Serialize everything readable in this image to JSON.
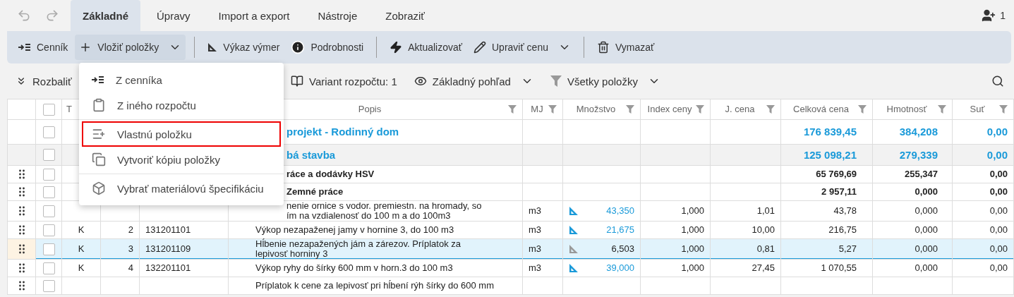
{
  "tabs": [
    {
      "label": "Základné",
      "selected": true
    },
    {
      "label": "Úpravy",
      "selected": false
    },
    {
      "label": "Import a export",
      "selected": false
    },
    {
      "label": "Nástroje",
      "selected": false
    },
    {
      "label": "Zobraziť",
      "selected": false
    }
  ],
  "user_count": "1",
  "ribbon": [
    {
      "kind": "pricelist",
      "label": "Cenník"
    },
    {
      "kind": "insert",
      "label": "Vložiť položky",
      "expanded": true
    },
    {
      "kind": "separator"
    },
    {
      "kind": "measure",
      "label": "Výkaz výmer"
    },
    {
      "kind": "info",
      "label": "Podrobnosti"
    },
    {
      "kind": "separator"
    },
    {
      "kind": "update",
      "label": "Aktualizovať"
    },
    {
      "kind": "edit",
      "label": "Upraviť cenu",
      "dropdown": true
    },
    {
      "kind": "separator"
    },
    {
      "kind": "delete",
      "label": "Vymazať"
    }
  ],
  "view_bar": [
    {
      "kind": "expand",
      "label": "Rozbaliť"
    },
    {
      "kind": "variant",
      "label": "Variant rozpočtu: 1"
    },
    {
      "kind": "view",
      "label": "Základný pohľad"
    },
    {
      "kind": "filter",
      "label": "Všetky položky"
    }
  ],
  "menu": [
    {
      "kind": "pricelist",
      "label": "Z cenníka",
      "highlighted": false
    },
    {
      "kind": "budget",
      "label": "Z iného rozpočtu",
      "highlighted": false
    },
    {
      "kind": "divider"
    },
    {
      "kind": "custom",
      "label": "Vlastnú položku",
      "highlighted": true
    },
    {
      "kind": "copy",
      "label": "Vytvoriť kópiu položky",
      "highlighted": false
    },
    {
      "kind": "divider"
    },
    {
      "kind": "material",
      "label": "Vybrať materiálovú špecifikáciu",
      "highlighted": false
    }
  ],
  "table": {
    "all_checked": false,
    "columns": [
      {
        "label": "T"
      },
      {},
      {},
      {
        "label": "Popis",
        "filter": true
      },
      {
        "label": "MJ",
        "filter": true
      },
      {
        "label": "Množstvo",
        "filter": true
      },
      {
        "label": "Index ceny",
        "filter": true
      },
      {
        "label": "J. cena",
        "filter": true
      },
      {
        "label": "Celková cena",
        "filter": true
      },
      {
        "label": "Hmotnosť",
        "filter": true
      },
      {
        "label": "Suť",
        "filter": true
      }
    ],
    "rows": [
      {
        "kind": "project",
        "covered": true,
        "selected": false,
        "popis": "projekt - Rodinný dom",
        "total": "176 839,45",
        "weight": "384,208",
        "debris": "0,00"
      },
      {
        "kind": "object",
        "covered": true,
        "selected": false,
        "popis": "bá stavba",
        "total": "125 098,21",
        "weight": "279,339",
        "debris": "0,00"
      },
      {
        "kind": "section",
        "covered": true,
        "selected": false,
        "popis": "ráce a dodávky HSV",
        "total": "65 769,69",
        "weight": "255,347",
        "debris": "0,00"
      },
      {
        "kind": "section",
        "covered": true,
        "selected": false,
        "popis": "Zemné práce",
        "total": "2 957,11",
        "weight": "0,000",
        "debris": "0,00"
      },
      {
        "kind": "item",
        "covered": true,
        "selected": false,
        "linked": true,
        "popis": "nenie ornice s vodor. premiestn. na hromady, so ím na vzdialenosť do 100 m a do 100m3",
        "unit": "m3",
        "qty": "43,350",
        "index": "1,000",
        "price": "1,01",
        "total": "43,78",
        "weight": "0,000",
        "debris": "0,00"
      },
      {
        "kind": "item",
        "covered": false,
        "selected": false,
        "linked": true,
        "tv": "K",
        "number": "2",
        "code": "131201101",
        "popis": "Výkop nezapaženej jamy v hornine 3, do 100 m3",
        "unit": "m3",
        "qty": "21,675",
        "index": "1,000",
        "price": "10,00",
        "total": "216,75",
        "weight": "0,000",
        "debris": "0,00"
      },
      {
        "kind": "item",
        "covered": false,
        "selected": true,
        "linked": false,
        "tv": "K",
        "number": "3",
        "code": "131201109",
        "popis": "Hĺbenie nezapažených jám a zárezov. Príplatok za lepivosť horniny 3",
        "unit": "m3",
        "qty": "6,503",
        "index": "1,000",
        "price": "0,81",
        "total": "5,27",
        "weight": "0,000",
        "debris": "0,00"
      },
      {
        "kind": "item",
        "covered": false,
        "selected": false,
        "linked": true,
        "tv": "K",
        "number": "4",
        "code": "132201101",
        "popis": "Výkop ryhy do šírky 600 mm v horn.3 do 100 m3",
        "unit": "m3",
        "qty": "39,000",
        "index": "1,000",
        "price": "27,45",
        "total": "1 070,55",
        "weight": "0,000",
        "debris": "0,00"
      },
      {
        "kind": "item",
        "covered": false,
        "selected": false,
        "popis": "Príplatok k cene za lepivosť pri hĺbení rýh šírky do 600 mm"
      }
    ]
  }
}
